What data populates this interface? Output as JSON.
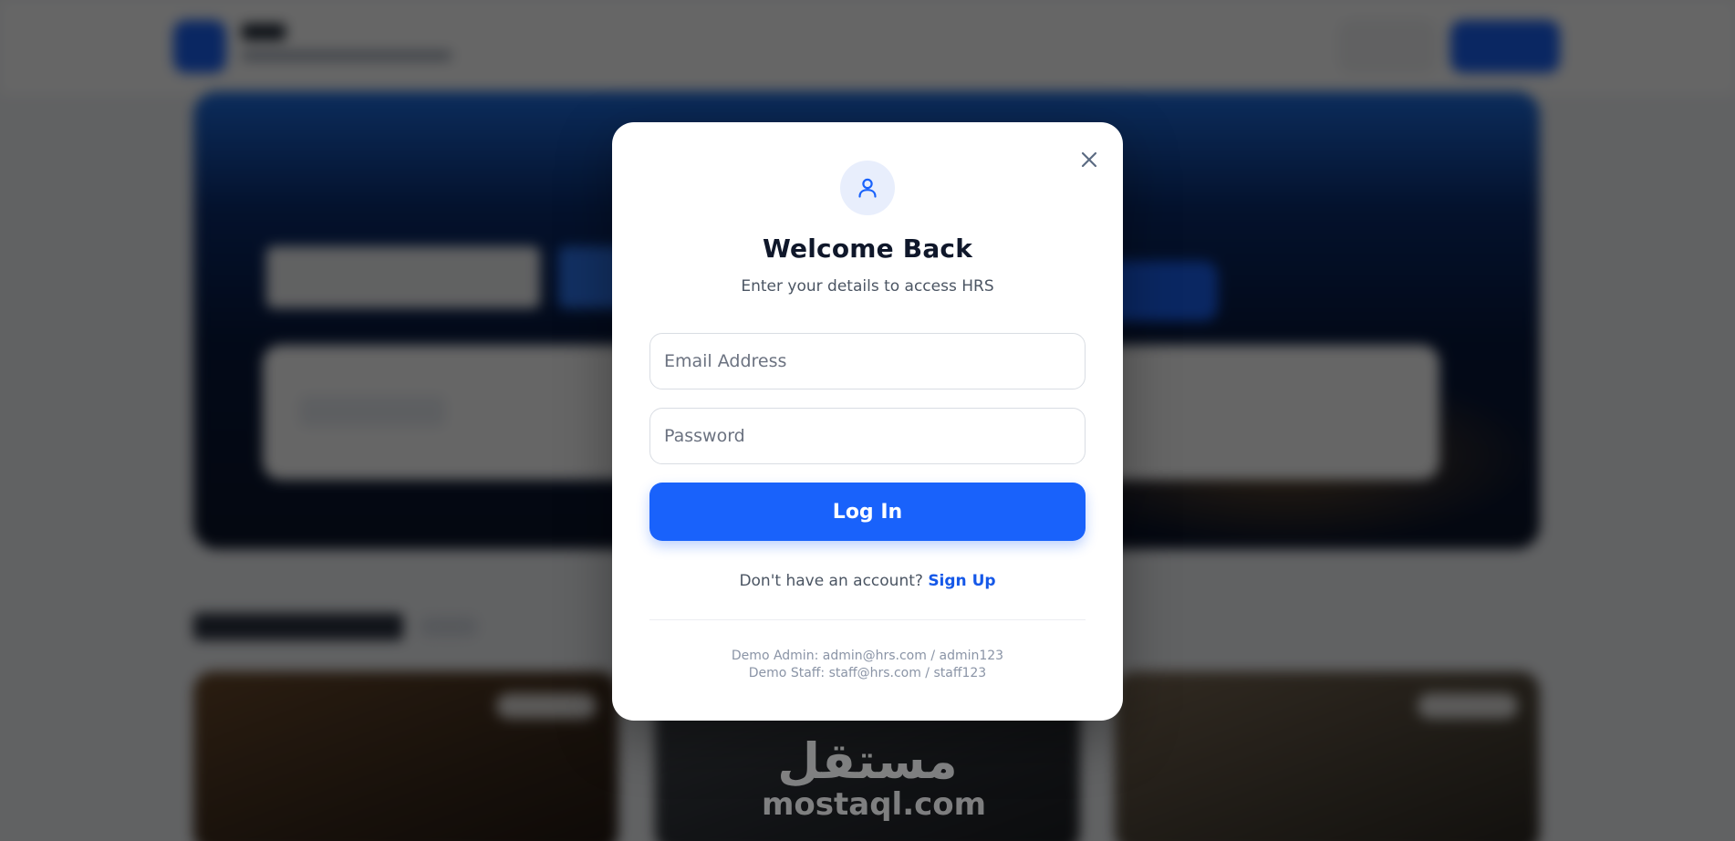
{
  "modal": {
    "title": "Welcome Back",
    "subtitle": "Enter your details to access HRS",
    "email_placeholder": "Email Address",
    "email_value": "",
    "password_placeholder": "Password",
    "password_value": "",
    "login_label": "Log In",
    "signup_prompt": "Don't have an account?",
    "signup_link": "Sign Up",
    "demo_admin": "Demo Admin: admin@hrs.com / admin123",
    "demo_staff": "Demo Staff: staff@hrs.com / staff123",
    "icons": {
      "avatar": "user-icon",
      "close": "close-icon"
    }
  },
  "colors": {
    "primary": "#1962fb",
    "link": "#1558e8",
    "title": "#0f172a",
    "overlay": "rgba(0,0,0,0.60)"
  },
  "watermark": {
    "arabic": "مستقل",
    "latin": "mostaql.com"
  }
}
